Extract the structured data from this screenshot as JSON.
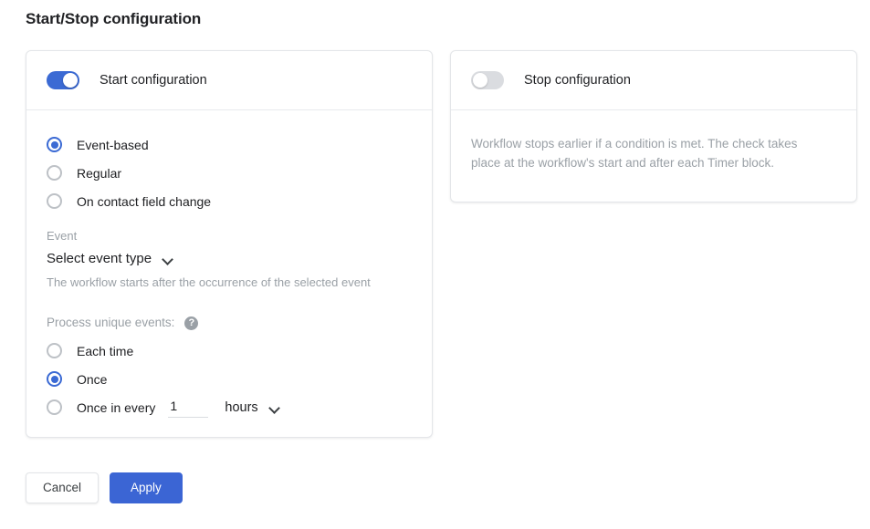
{
  "page": {
    "title": "Start/Stop configuration"
  },
  "start_card": {
    "toggle_state": "on",
    "header_label": "Start configuration",
    "trigger_options": [
      {
        "label": "Event-based",
        "selected": true
      },
      {
        "label": "Regular",
        "selected": false
      },
      {
        "label": "On contact field change",
        "selected": false
      }
    ],
    "event_field": {
      "caption": "Event",
      "selected_value": "Select event type",
      "hint": "The workflow starts after the occurrence of the selected event"
    },
    "process_unique": {
      "label": "Process unique events:",
      "help_icon": "help-circle-icon",
      "help_glyph": "?",
      "options": [
        {
          "label": "Each time",
          "selected": false
        },
        {
          "label": "Once",
          "selected": true
        },
        {
          "label": "Once in every",
          "selected": false
        }
      ],
      "interval_value": "1",
      "interval_unit": "hours"
    }
  },
  "stop_card": {
    "toggle_state": "off",
    "header_label": "Stop configuration",
    "description": "Workflow stops earlier if a condition is met. The check takes place at the workflow's start and after each Timer block."
  },
  "footer": {
    "cancel_label": "Cancel",
    "apply_label": "Apply"
  },
  "colors": {
    "accent_blue": "#3b65d4",
    "toggle_on": "#3b6ad4",
    "toggle_off": "#dadce0",
    "muted_text": "#9aa0a6",
    "primary_text": "#202124",
    "card_border": "#e4e6e9"
  }
}
